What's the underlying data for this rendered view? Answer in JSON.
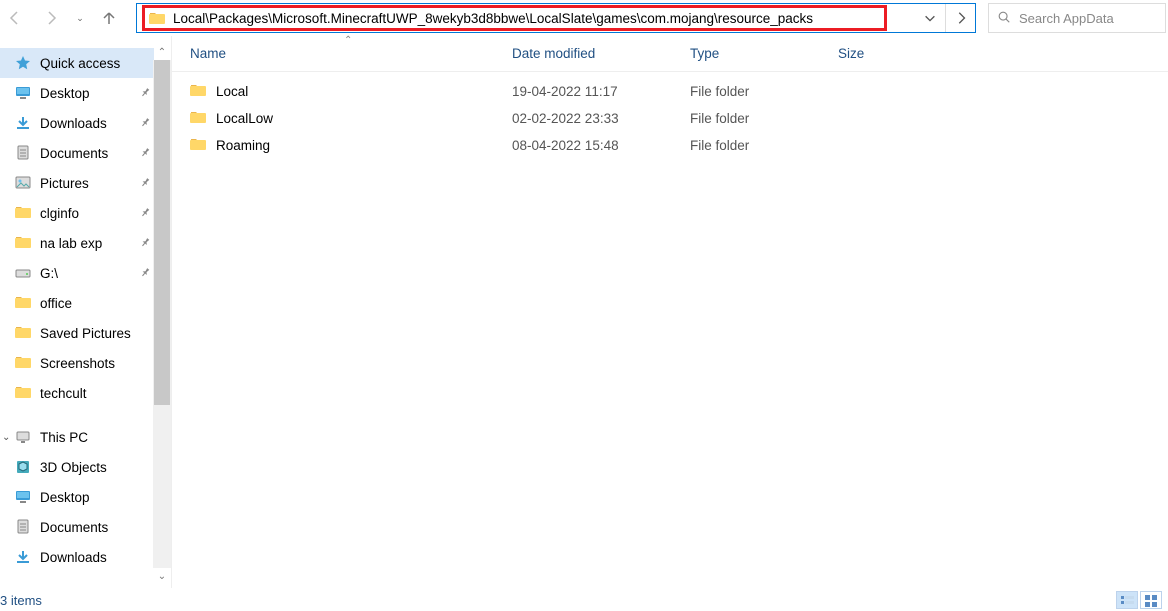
{
  "toolbar": {
    "path": "Local\\Packages\\Microsoft.MinecraftUWP_8wekyb3d8bbwe\\LocalSlate\\games\\com.mojang\\resource_packs",
    "search_placeholder": "Search AppData"
  },
  "columns": {
    "name": "Name",
    "date": "Date modified",
    "type": "Type",
    "size": "Size"
  },
  "rows": [
    {
      "name": "Local",
      "date": "19-04-2022 11:17",
      "type": "File folder"
    },
    {
      "name": "LocalLow",
      "date": "02-02-2022 23:33",
      "type": "File folder"
    },
    {
      "name": "Roaming",
      "date": "08-04-2022 15:48",
      "type": "File folder"
    }
  ],
  "sidebar": {
    "quick_access": "Quick access",
    "quick_items": [
      {
        "label": "Desktop",
        "icon": "desktop",
        "pinned": true
      },
      {
        "label": "Downloads",
        "icon": "download",
        "pinned": true
      },
      {
        "label": "Documents",
        "icon": "doc",
        "pinned": true
      },
      {
        "label": "Pictures",
        "icon": "pic",
        "pinned": true
      },
      {
        "label": "clginfo",
        "icon": "folder",
        "pinned": true
      },
      {
        "label": "na lab exp",
        "icon": "folder",
        "pinned": true
      },
      {
        "label": "G:\\",
        "icon": "drive",
        "pinned": true
      },
      {
        "label": "office",
        "icon": "folder",
        "pinned": false
      },
      {
        "label": "Saved Pictures",
        "icon": "folder",
        "pinned": false
      },
      {
        "label": "Screenshots",
        "icon": "folder",
        "pinned": false
      },
      {
        "label": "techcult",
        "icon": "folder",
        "pinned": false
      }
    ],
    "this_pc": "This PC",
    "pc_items": [
      {
        "label": "3D Objects",
        "icon": "3d"
      },
      {
        "label": "Desktop",
        "icon": "desktop"
      },
      {
        "label": "Documents",
        "icon": "doc"
      },
      {
        "label": "Downloads",
        "icon": "download"
      }
    ]
  },
  "status": {
    "items": "3 items"
  }
}
